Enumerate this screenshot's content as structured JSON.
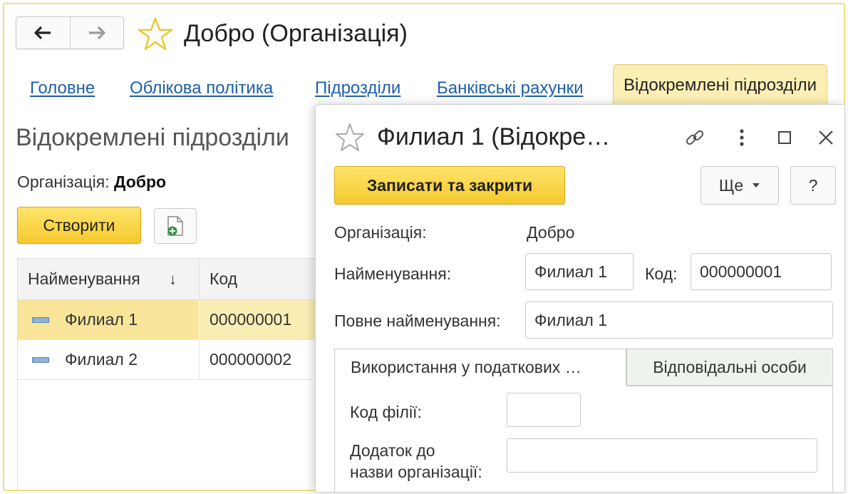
{
  "window": {
    "title": "Добро (Організація)"
  },
  "tabs": [
    {
      "label": "Головне"
    },
    {
      "label": "Облікова політика"
    },
    {
      "label": "Підрозділи"
    },
    {
      "label": "Банківські рахунки"
    },
    {
      "label": "Відокремлені підрозділи",
      "active": true
    }
  ],
  "list": {
    "title": "Відокремлені підрозділи",
    "org_label": "Організація:",
    "org_value": "Добро",
    "create_label": "Створити",
    "columns": [
      "Найменування",
      "Код"
    ],
    "sort_indicator": "↓",
    "rows": [
      {
        "name": "Филиал 1",
        "code": "000000001",
        "selected": true
      },
      {
        "name": "Филиал 2",
        "code": "000000002",
        "selected": false
      }
    ]
  },
  "dialog": {
    "title": "Филиал 1 (Відокре…",
    "save_close_label": "Записати та закрити",
    "more_label": "Ще",
    "help_label": "?",
    "org_label": "Організація:",
    "org_value": "Добро",
    "name_label": "Найменування:",
    "name_value": "Филиал 1",
    "code_label": "Код:",
    "code_value": "000000001",
    "full_name_label": "Повне найменування:",
    "full_name_value": "Филиал 1",
    "subtabs": [
      {
        "label": "Використання у податкових …",
        "active": true
      },
      {
        "label": "Відповідальні особи",
        "active": false
      }
    ],
    "branch_code_label": "Код філії:",
    "branch_code_value": "",
    "addition_label_line1": "Додаток до",
    "addition_label_line2": "назви організації:",
    "addition_value": ""
  },
  "icons": {
    "back": "arrow-left-icon",
    "forward": "arrow-right-icon",
    "favorite": "star-icon",
    "copy_create": "document-add-icon",
    "link": "link-icon",
    "more": "kebab-menu-icon",
    "maximize": "maximize-icon",
    "close": "close-icon",
    "row": "row-item-icon",
    "dropdown": "chevron-down-icon"
  },
  "colors": {
    "accent_yellow": "#f5c92c",
    "link_blue": "#1f5fa8",
    "selected_row": "#fbeeb4",
    "frame_border": "#f2dc7a"
  }
}
